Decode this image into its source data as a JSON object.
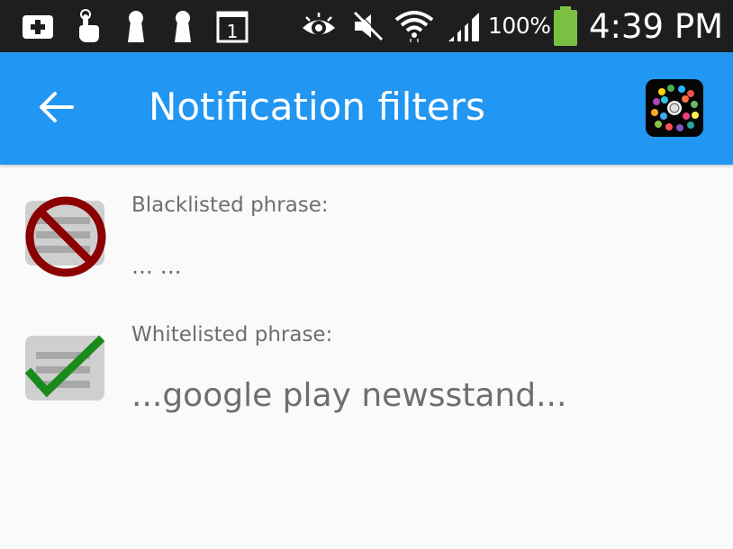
{
  "status_bar": {
    "battery_percent": "100%",
    "time": "4:39 PM",
    "icons": [
      "add-box-icon",
      "touch-icon",
      "keyhole-icon",
      "keyhole-icon",
      "calendar-1-icon",
      "eye-icon",
      "mute-icon",
      "wifi-icon",
      "signal-icon",
      "battery-icon"
    ]
  },
  "app_bar": {
    "title": "Notification filters",
    "back_icon": "arrow-back-icon",
    "app_icon": "app-logo-icon"
  },
  "filters": [
    {
      "label": "Blacklisted phrase:",
      "value": "... ...",
      "icon": "blocked-notification-icon"
    },
    {
      "label": "Whitelisted phrase:",
      "value": "...google play newsstand...",
      "icon": "allowed-notification-icon"
    }
  ],
  "colors": {
    "status_bar": "#1e1e1e",
    "app_bar": "#2196f3",
    "background": "#fafafa",
    "text_secondary": "#6e6e6e",
    "block_red": "#8b0000",
    "check_green": "#1a8a1a",
    "battery_green": "#7cc043"
  }
}
